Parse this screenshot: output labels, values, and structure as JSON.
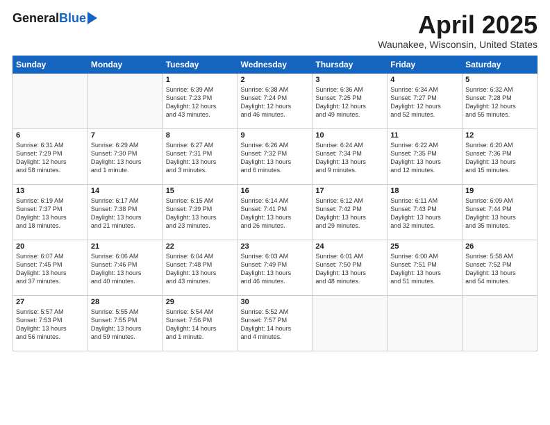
{
  "logo": {
    "general": "General",
    "blue": "Blue"
  },
  "header": {
    "month": "April 2025",
    "location": "Waunakee, Wisconsin, United States"
  },
  "days_of_week": [
    "Sunday",
    "Monday",
    "Tuesday",
    "Wednesday",
    "Thursday",
    "Friday",
    "Saturday"
  ],
  "weeks": [
    [
      {
        "day": "",
        "info": ""
      },
      {
        "day": "",
        "info": ""
      },
      {
        "day": "1",
        "info": "Sunrise: 6:39 AM\nSunset: 7:23 PM\nDaylight: 12 hours\nand 43 minutes."
      },
      {
        "day": "2",
        "info": "Sunrise: 6:38 AM\nSunset: 7:24 PM\nDaylight: 12 hours\nand 46 minutes."
      },
      {
        "day": "3",
        "info": "Sunrise: 6:36 AM\nSunset: 7:25 PM\nDaylight: 12 hours\nand 49 minutes."
      },
      {
        "day": "4",
        "info": "Sunrise: 6:34 AM\nSunset: 7:27 PM\nDaylight: 12 hours\nand 52 minutes."
      },
      {
        "day": "5",
        "info": "Sunrise: 6:32 AM\nSunset: 7:28 PM\nDaylight: 12 hours\nand 55 minutes."
      }
    ],
    [
      {
        "day": "6",
        "info": "Sunrise: 6:31 AM\nSunset: 7:29 PM\nDaylight: 12 hours\nand 58 minutes."
      },
      {
        "day": "7",
        "info": "Sunrise: 6:29 AM\nSunset: 7:30 PM\nDaylight: 13 hours\nand 1 minute."
      },
      {
        "day": "8",
        "info": "Sunrise: 6:27 AM\nSunset: 7:31 PM\nDaylight: 13 hours\nand 3 minutes."
      },
      {
        "day": "9",
        "info": "Sunrise: 6:26 AM\nSunset: 7:32 PM\nDaylight: 13 hours\nand 6 minutes."
      },
      {
        "day": "10",
        "info": "Sunrise: 6:24 AM\nSunset: 7:34 PM\nDaylight: 13 hours\nand 9 minutes."
      },
      {
        "day": "11",
        "info": "Sunrise: 6:22 AM\nSunset: 7:35 PM\nDaylight: 13 hours\nand 12 minutes."
      },
      {
        "day": "12",
        "info": "Sunrise: 6:20 AM\nSunset: 7:36 PM\nDaylight: 13 hours\nand 15 minutes."
      }
    ],
    [
      {
        "day": "13",
        "info": "Sunrise: 6:19 AM\nSunset: 7:37 PM\nDaylight: 13 hours\nand 18 minutes."
      },
      {
        "day": "14",
        "info": "Sunrise: 6:17 AM\nSunset: 7:38 PM\nDaylight: 13 hours\nand 21 minutes."
      },
      {
        "day": "15",
        "info": "Sunrise: 6:15 AM\nSunset: 7:39 PM\nDaylight: 13 hours\nand 23 minutes."
      },
      {
        "day": "16",
        "info": "Sunrise: 6:14 AM\nSunset: 7:41 PM\nDaylight: 13 hours\nand 26 minutes."
      },
      {
        "day": "17",
        "info": "Sunrise: 6:12 AM\nSunset: 7:42 PM\nDaylight: 13 hours\nand 29 minutes."
      },
      {
        "day": "18",
        "info": "Sunrise: 6:11 AM\nSunset: 7:43 PM\nDaylight: 13 hours\nand 32 minutes."
      },
      {
        "day": "19",
        "info": "Sunrise: 6:09 AM\nSunset: 7:44 PM\nDaylight: 13 hours\nand 35 minutes."
      }
    ],
    [
      {
        "day": "20",
        "info": "Sunrise: 6:07 AM\nSunset: 7:45 PM\nDaylight: 13 hours\nand 37 minutes."
      },
      {
        "day": "21",
        "info": "Sunrise: 6:06 AM\nSunset: 7:46 PM\nDaylight: 13 hours\nand 40 minutes."
      },
      {
        "day": "22",
        "info": "Sunrise: 6:04 AM\nSunset: 7:48 PM\nDaylight: 13 hours\nand 43 minutes."
      },
      {
        "day": "23",
        "info": "Sunrise: 6:03 AM\nSunset: 7:49 PM\nDaylight: 13 hours\nand 46 minutes."
      },
      {
        "day": "24",
        "info": "Sunrise: 6:01 AM\nSunset: 7:50 PM\nDaylight: 13 hours\nand 48 minutes."
      },
      {
        "day": "25",
        "info": "Sunrise: 6:00 AM\nSunset: 7:51 PM\nDaylight: 13 hours\nand 51 minutes."
      },
      {
        "day": "26",
        "info": "Sunrise: 5:58 AM\nSunset: 7:52 PM\nDaylight: 13 hours\nand 54 minutes."
      }
    ],
    [
      {
        "day": "27",
        "info": "Sunrise: 5:57 AM\nSunset: 7:53 PM\nDaylight: 13 hours\nand 56 minutes."
      },
      {
        "day": "28",
        "info": "Sunrise: 5:55 AM\nSunset: 7:55 PM\nDaylight: 13 hours\nand 59 minutes."
      },
      {
        "day": "29",
        "info": "Sunrise: 5:54 AM\nSunset: 7:56 PM\nDaylight: 14 hours\nand 1 minute."
      },
      {
        "day": "30",
        "info": "Sunrise: 5:52 AM\nSunset: 7:57 PM\nDaylight: 14 hours\nand 4 minutes."
      },
      {
        "day": "",
        "info": ""
      },
      {
        "day": "",
        "info": ""
      },
      {
        "day": "",
        "info": ""
      }
    ]
  ]
}
